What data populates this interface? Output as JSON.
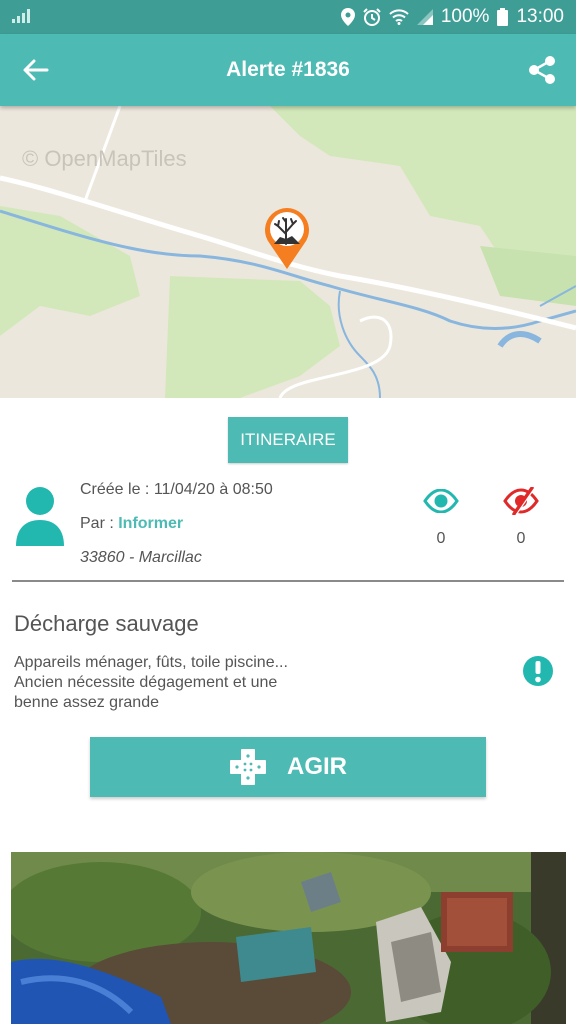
{
  "status_bar": {
    "battery": "100%",
    "time": "13:00",
    "icons": [
      "signal-icon",
      "location-icon",
      "alarm-icon",
      "wifi-icon",
      "cell-signal-icon",
      "battery-icon"
    ]
  },
  "app_bar": {
    "title": "Alerte #1836",
    "back_icon": "arrow-left-icon",
    "share_icon": "share-icon"
  },
  "map": {
    "attribution": "© OpenMapTiles",
    "pin_icon": "dead-tree-dump-icon",
    "colors": {
      "background": "#ece7dc",
      "vegetation": "#cfe6b4",
      "water": "#88b6de",
      "road": "#ffffff",
      "pin": "#f47e20"
    }
  },
  "itinerary": {
    "label": "ITINERAIRE"
  },
  "alert": {
    "created": "Créée le : 11/04/20 à 08:50",
    "author_prefix": "Par : ",
    "author": "Informer",
    "location": "33860 - Marcillac",
    "category": "Décharge sauvage",
    "description": "Appareils ménager, fûts, toile piscine... Ancien nécessite dégagement et une benne assez grande"
  },
  "stats": {
    "seen_count": "0",
    "unseen_count": "0",
    "seen_icon": "eye-icon",
    "unseen_icon": "eye-off-icon"
  },
  "actions": {
    "act_label": "AGIR",
    "act_icon": "bandage-cross-icon"
  },
  "colors": {
    "primary": "#4dbab3",
    "status_bar": "#3e9e96",
    "danger": "#e02a2a",
    "text": "#555555"
  }
}
